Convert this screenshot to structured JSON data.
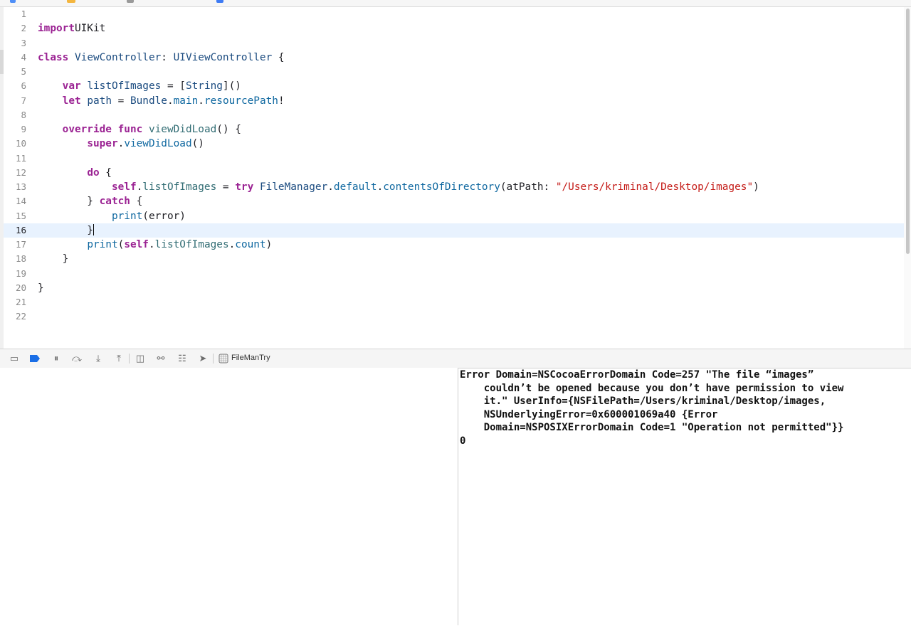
{
  "editor": {
    "current_line": 16,
    "lines": [
      {
        "n": "1",
        "tokens": []
      },
      {
        "n": "2",
        "tokens": [
          [
            "kw",
            "import"
          ],
          [
            "",
            "UIKit"
          ]
        ]
      },
      {
        "n": "3",
        "tokens": []
      },
      {
        "n": "4",
        "tokens": [
          [
            "kw",
            "class"
          ],
          [
            "",
            ""
          ],
          [
            "ty",
            "ViewController"
          ],
          [
            "",
            ": "
          ],
          [
            "ty",
            "UIViewController"
          ],
          [
            "",
            " {"
          ]
        ]
      },
      {
        "n": "5",
        "tokens": []
      },
      {
        "n": "6",
        "tokens": [
          [
            "",
            "    "
          ],
          [
            "kw",
            "var"
          ],
          [
            "",
            " "
          ],
          [
            "ty",
            "listOfImages"
          ],
          [
            "",
            " = ["
          ],
          [
            "ty",
            "String"
          ],
          [
            "",
            "]()"
          ]
        ]
      },
      {
        "n": "7",
        "tokens": [
          [
            "",
            "    "
          ],
          [
            "kw",
            "let"
          ],
          [
            "",
            " "
          ],
          [
            "ty",
            "path"
          ],
          [
            "",
            " = "
          ],
          [
            "ty",
            "Bundle"
          ],
          [
            "",
            "."
          ],
          [
            "pr",
            "main"
          ],
          [
            "",
            "."
          ],
          [
            "pr",
            "resourcePath"
          ],
          [
            "",
            "!"
          ]
        ]
      },
      {
        "n": "8",
        "tokens": []
      },
      {
        "n": "9",
        "tokens": [
          [
            "",
            "    "
          ],
          [
            "kw",
            "override"
          ],
          [
            "",
            " "
          ],
          [
            "kw",
            "func"
          ],
          [
            "",
            " "
          ],
          [
            "fn",
            "viewDidLoad"
          ],
          [
            "",
            "() {"
          ]
        ]
      },
      {
        "n": "10",
        "tokens": [
          [
            "",
            "        "
          ],
          [
            "kw",
            "super"
          ],
          [
            "",
            "."
          ],
          [
            "pr",
            "viewDidLoad"
          ],
          [
            "",
            "()"
          ]
        ]
      },
      {
        "n": "11",
        "tokens": []
      },
      {
        "n": "12",
        "tokens": [
          [
            "",
            "        "
          ],
          [
            "kw",
            "do"
          ],
          [
            "",
            " {"
          ]
        ]
      },
      {
        "n": "13",
        "tokens": [
          [
            "",
            "            "
          ],
          [
            "kw",
            "self"
          ],
          [
            "",
            "."
          ],
          [
            "fn",
            "listOfImages"
          ],
          [
            "",
            " = "
          ],
          [
            "kw",
            "try"
          ],
          [
            "",
            " "
          ],
          [
            "ty",
            "FileManager"
          ],
          [
            "",
            "."
          ],
          [
            "pr",
            "default"
          ],
          [
            "",
            "."
          ],
          [
            "pr",
            "contentsOfDirectory"
          ],
          [
            "",
            "(atPath: "
          ],
          [
            "st",
            "\"/Users/kriminal/Desktop/images\""
          ],
          [
            "",
            ")"
          ]
        ]
      },
      {
        "n": "14",
        "tokens": [
          [
            "",
            "        } "
          ],
          [
            "kw",
            "catch"
          ],
          [
            "",
            " {"
          ]
        ]
      },
      {
        "n": "15",
        "tokens": [
          [
            "",
            "            "
          ],
          [
            "pr",
            "print"
          ],
          [
            "",
            "(error)"
          ]
        ]
      },
      {
        "n": "16",
        "tokens": [
          [
            "",
            "        }"
          ],
          [
            "caret",
            ""
          ]
        ]
      },
      {
        "n": "17",
        "tokens": [
          [
            "",
            "        "
          ],
          [
            "pr",
            "print"
          ],
          [
            "",
            "("
          ],
          [
            "kw",
            "self"
          ],
          [
            "",
            "."
          ],
          [
            "fn",
            "listOfImages"
          ],
          [
            "",
            "."
          ],
          [
            "pr",
            "count"
          ],
          [
            "",
            ")"
          ]
        ]
      },
      {
        "n": "18",
        "tokens": [
          [
            "",
            "    }"
          ]
        ]
      },
      {
        "n": "19",
        "tokens": []
      },
      {
        "n": "20",
        "tokens": [
          [
            "",
            "}"
          ]
        ]
      },
      {
        "n": "21",
        "tokens": []
      },
      {
        "n": "22",
        "tokens": []
      }
    ]
  },
  "debugbar": {
    "target_label": "FileManTry",
    "buttons": [
      {
        "name": "hide-debug-area-icon",
        "glyph": "▭"
      },
      {
        "name": "breakpoints-toggle-icon",
        "glyph": ""
      },
      {
        "name": "pause-icon",
        "glyph": "⏸"
      },
      {
        "name": "step-over-icon",
        "glyph": "⤼"
      },
      {
        "name": "step-into-icon",
        "glyph": "⤓"
      },
      {
        "name": "step-out-icon",
        "glyph": "⤒"
      },
      {
        "name": "view-hierarchy-icon",
        "glyph": "◫"
      },
      {
        "name": "memory-graph-icon",
        "glyph": "⚯"
      },
      {
        "name": "environment-overrides-icon",
        "glyph": "☷"
      },
      {
        "name": "simulate-location-icon",
        "glyph": "➤"
      }
    ],
    "colors": {
      "breakpoint_active": "#1a6ee6",
      "icon": "#6b6b6b"
    }
  },
  "console": {
    "lines": [
      "Error Domain=NSCocoaErrorDomain Code=257 \"The file “images”",
      "    couldn’t be opened because you don’t have permission to view",
      "    it.\" UserInfo={NSFilePath=/Users/kriminal/Desktop/images,",
      "    NSUnderlyingError=0x600001069a40 {Error",
      "    Domain=NSPOSIXErrorDomain Code=1 \"Operation not permitted\"}}",
      "0"
    ]
  }
}
